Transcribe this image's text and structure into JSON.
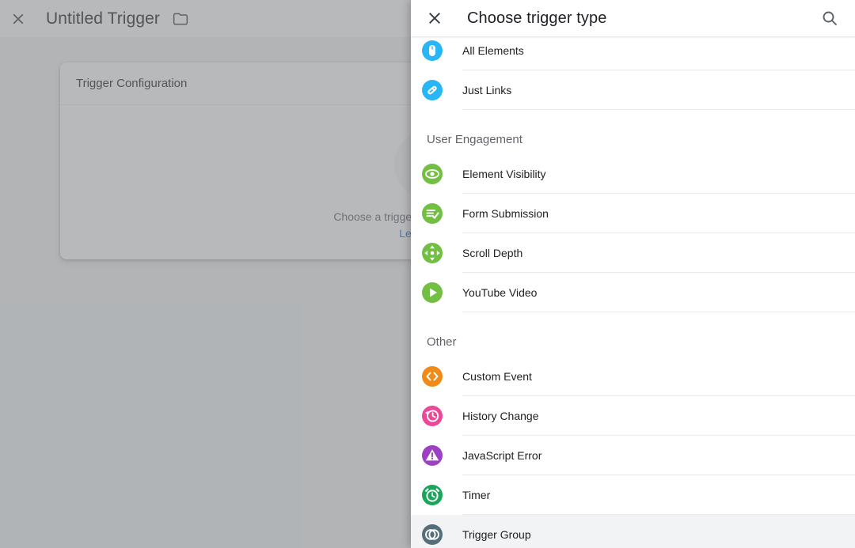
{
  "background_app": {
    "close_icon": "close-icon",
    "title": "Untitled Trigger",
    "folder_icon": "folder-icon",
    "card": {
      "header_title": "Trigger Configuration",
      "placeholder_icon": "trigger-group-placeholder-icon",
      "hint_text": "Choose a trigger type to begin setup...",
      "learn_more_label": "Learn More"
    }
  },
  "panel": {
    "close_icon": "close-icon",
    "title": "Choose trigger type",
    "search_icon": "search-icon",
    "sections": [
      {
        "heading": null,
        "items": [
          {
            "label": "All Elements",
            "icon": "mouse-icon",
            "color": "#29b6f6",
            "selected": false
          },
          {
            "label": "Just Links",
            "icon": "link-icon",
            "color": "#29b6f6",
            "selected": false
          }
        ]
      },
      {
        "heading": "User Engagement",
        "items": [
          {
            "label": "Element Visibility",
            "icon": "eye-icon",
            "color": "#73bf43",
            "selected": false
          },
          {
            "label": "Form Submission",
            "icon": "form-check-icon",
            "color": "#73bf43",
            "selected": false
          },
          {
            "label": "Scroll Depth",
            "icon": "scroll-arrows-icon",
            "color": "#73bf43",
            "selected": false
          },
          {
            "label": "YouTube Video",
            "icon": "play-icon",
            "color": "#73bf43",
            "selected": false
          }
        ]
      },
      {
        "heading": "Other",
        "items": [
          {
            "label": "Custom Event",
            "icon": "code-brackets-icon",
            "color": "#ef8b19",
            "selected": false
          },
          {
            "label": "History Change",
            "icon": "history-clock-icon",
            "color": "#ec4899",
            "selected": false
          },
          {
            "label": "JavaScript Error",
            "icon": "warning-triangle-icon",
            "color": "#9c40c4",
            "selected": false
          },
          {
            "label": "Timer",
            "icon": "alarm-clock-icon",
            "color": "#19a55a",
            "selected": false
          },
          {
            "label": "Trigger Group",
            "icon": "trigger-group-icon",
            "color": "#546e7a",
            "selected": true
          }
        ]
      }
    ]
  },
  "annotation": {
    "arrow_icon": "left-pointing-arrow-annotation",
    "color": "#22b422",
    "points_at": "Trigger Group"
  },
  "colors": {
    "page_background": "#f1f3f4",
    "panel_background": "#ffffff",
    "selected_row": "#f1f3f4",
    "divider": "#e8eaed",
    "primary_text": "#202124",
    "secondary_text": "#5f6368",
    "link": "#1a73e8"
  }
}
